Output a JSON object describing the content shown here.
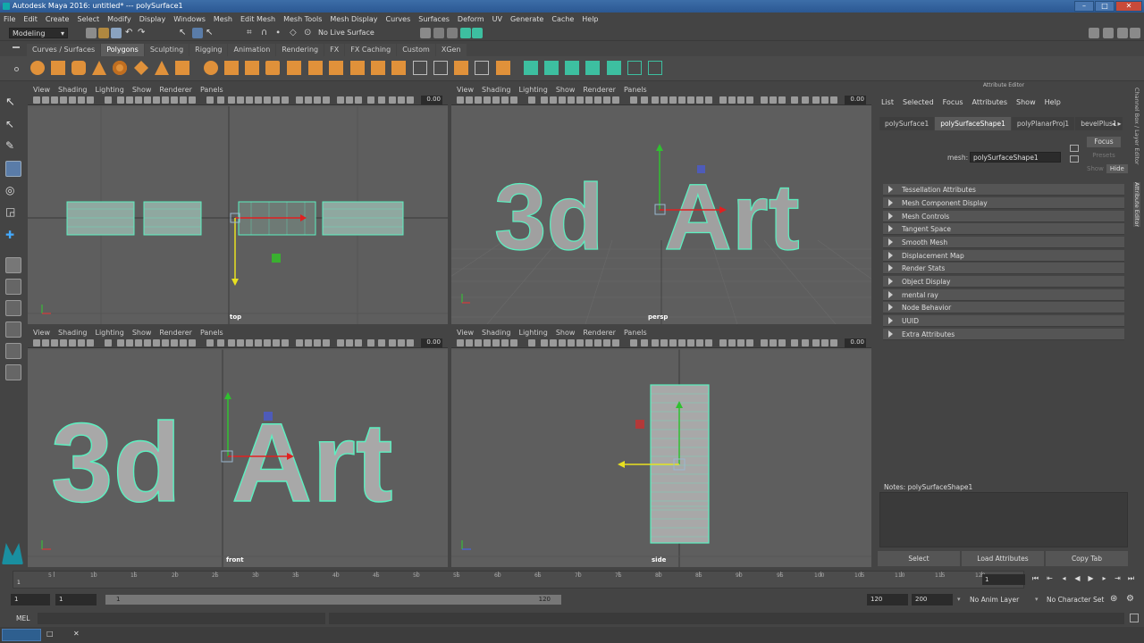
{
  "window": {
    "title": "Autodesk Maya 2016: untitled*  ---  polySurface1"
  },
  "menu": [
    "File",
    "Edit",
    "Create",
    "Select",
    "Modify",
    "Display",
    "Windows",
    "Mesh",
    "Edit Mesh",
    "Mesh Tools",
    "Mesh Display",
    "Curves",
    "Surfaces",
    "Deform",
    "UV",
    "Generate",
    "Cache",
    "Help"
  ],
  "status": {
    "mode": "Modeling",
    "live_surface": "No Live Surface"
  },
  "shelf_tabs": [
    "Curves / Surfaces",
    "Polygons",
    "Sculpting",
    "Rigging",
    "Animation",
    "Rendering",
    "FX",
    "FX Caching",
    "Custom",
    "XGen"
  ],
  "active_shelf": "Polygons",
  "viewport_menu": [
    "View",
    "Shading",
    "Lighting",
    "Show",
    "Renderer",
    "Panels"
  ],
  "viewports": [
    {
      "label": "top",
      "value": "0.00"
    },
    {
      "label": "persp",
      "value": "0.00"
    },
    {
      "label": "front",
      "value": "0.00"
    },
    {
      "label": "side",
      "value": "0.00"
    }
  ],
  "text3d": {
    "word1": "3d",
    "word2": "Art"
  },
  "attribute_editor": {
    "header": "Attribute Editor",
    "menu": [
      "List",
      "Selected",
      "Focus",
      "Attributes",
      "Show",
      "Help"
    ],
    "tabs": [
      "polySurface1",
      "polySurfaceShape1",
      "polyPlanarProj1",
      "bevelPlus1"
    ],
    "active_tab": "polySurfaceShape1",
    "mesh_label": "mesh:",
    "mesh_value": "polySurfaceShape1",
    "focus_button": "Focus",
    "presets_button": "Presets",
    "show_label": "Show",
    "hide_button": "Hide",
    "sections": [
      "Tessellation Attributes",
      "Mesh Component Display",
      "Mesh Controls",
      "Tangent Space",
      "Smooth Mesh",
      "Displacement Map",
      "Render Stats",
      "Object Display",
      "mental ray",
      "Node Behavior",
      "UUID",
      "Extra Attributes"
    ],
    "notes_label": "Notes:  polySurfaceShape1",
    "buttons": [
      "Select",
      "Load Attributes",
      "Copy Tab"
    ]
  },
  "side_tabs": [
    "Channel Box / Layer Editor",
    "Attribute Editor"
  ],
  "timeline": {
    "ticks": [
      "5",
      "10",
      "15",
      "20",
      "25",
      "30",
      "35",
      "40",
      "45",
      "50",
      "55",
      "60",
      "65",
      "70",
      "75",
      "80",
      "85",
      "90",
      "95",
      "100",
      "105",
      "110",
      "115",
      "120"
    ],
    "start_marker": "1",
    "current_time": "1"
  },
  "range": {
    "start": "1",
    "playback_start": "1",
    "slider_start": "1",
    "slider_end": "120",
    "playback_end": "120",
    "end": "200",
    "anim_layer": "No Anim Layer",
    "character_set": "No Character Set"
  },
  "command_line": {
    "label": "MEL"
  },
  "colors": {
    "wire": "#5cf0c0",
    "viewport_bg": "#5e5e5e",
    "active_tab": "#5d5d5d",
    "title_blue": "#2b5893"
  }
}
